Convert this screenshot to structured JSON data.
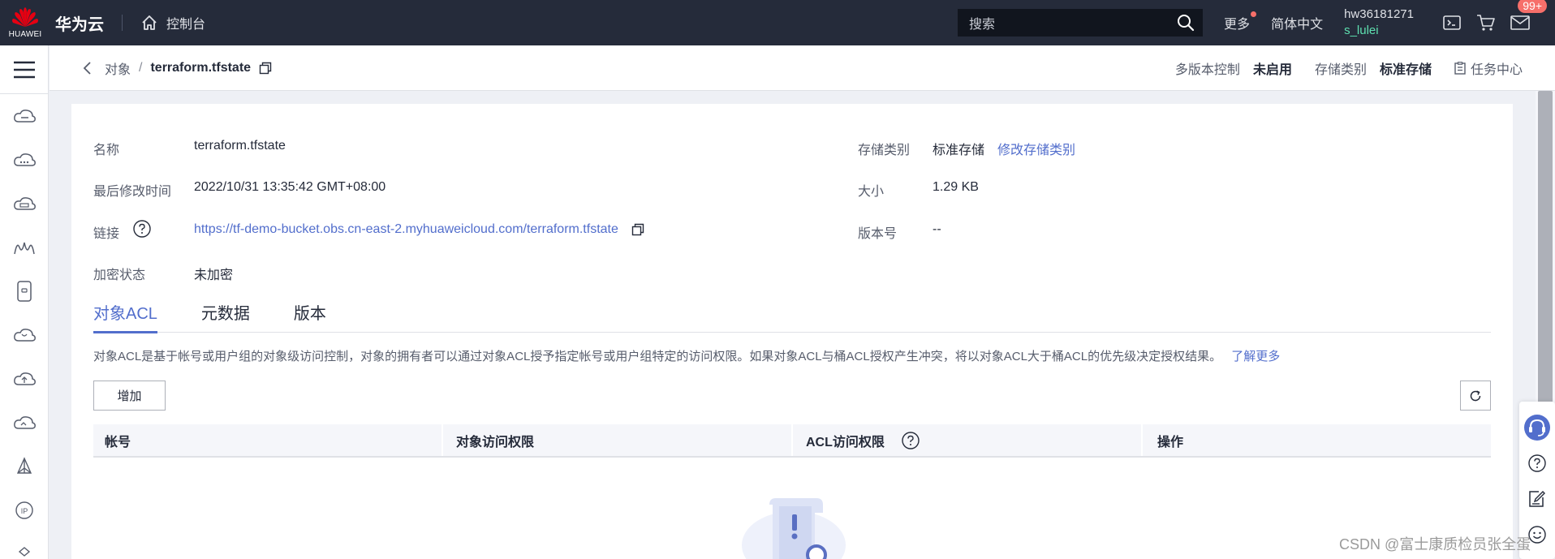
{
  "topbar": {
    "logo_text": "HUAWEI",
    "brand": "华为云",
    "console": "控制台",
    "search_placeholder": "搜索",
    "more": "更多",
    "language": "简体中文",
    "user_line1": "hw36181271",
    "user_line2": "s_lulei",
    "message_badge": "99+"
  },
  "subheader": {
    "breadcrumb_parent": "对象",
    "breadcrumb_sep": "/",
    "breadcrumb_current": "terraform.tfstate",
    "versioning_label": "多版本控制",
    "versioning_value": "未启用",
    "storage_label": "存储类别",
    "storage_value": "标准存储",
    "task_center": "任务中心"
  },
  "details": {
    "name_label": "名称",
    "name_value": "terraform.tfstate",
    "modified_label": "最后修改时间",
    "modified_value": "2022/10/31 13:35:42 GMT+08:00",
    "link_label": "链接",
    "link_value": "https://tf-demo-bucket.obs.cn-east-2.myhuaweicloud.com/terraform.tfstate",
    "encryption_label": "加密状态",
    "encryption_value": "未加密",
    "storage_class_label": "存储类别",
    "storage_class_value": "标准存储",
    "storage_class_action": "修改存储类别",
    "size_label": "大小",
    "size_value": "1.29 KB",
    "version_label": "版本号",
    "version_value": "--"
  },
  "tabs": [
    "对象ACL",
    "元数据",
    "版本"
  ],
  "acl": {
    "description": "对象ACL是基于帐号或用户组的对象级访问控制，对象的拥有者可以通过对象ACL授予指定帐号或用户组特定的访问权限。如果对象ACL与桶ACL授权产生冲突，将以对象ACL大于桶ACL的优先级决定授权结果。",
    "learn_more": "了解更多",
    "add_button": "增加",
    "columns": [
      "帐号",
      "对象访问权限",
      "ACL访问权限",
      "操作"
    ]
  },
  "watermark": "CSDN @富士康质检员张全蛋",
  "colors": {
    "topbar_bg": "#252b3a",
    "accent": "#526ecc",
    "user_green": "#5ee0b0",
    "badge_red": "#f66f6a"
  }
}
